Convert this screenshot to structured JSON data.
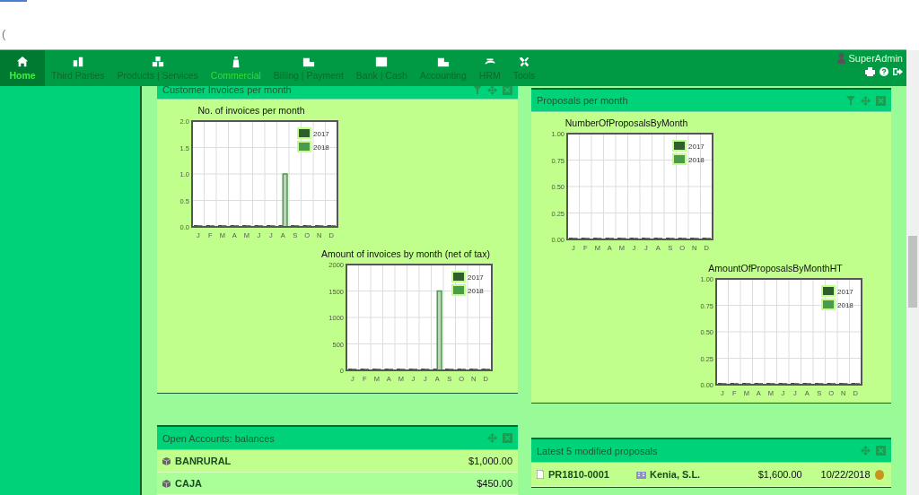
{
  "browser_stub": {
    "text": "("
  },
  "nav": {
    "items": [
      {
        "label": "Home",
        "selected": true,
        "active": false
      },
      {
        "label": "Third Parties",
        "selected": false,
        "active": false
      },
      {
        "label": "Products | Services",
        "selected": false,
        "active": false
      },
      {
        "label": "Commercial",
        "selected": false,
        "active": true
      },
      {
        "label": "Billing | Payment",
        "selected": false,
        "active": false
      },
      {
        "label": "Bank | Cash",
        "selected": false,
        "active": false
      },
      {
        "label": "Accounting",
        "selected": false,
        "active": false
      },
      {
        "label": "HRM",
        "selected": false,
        "active": false
      },
      {
        "label": "Tools",
        "selected": false,
        "active": false
      }
    ],
    "user": "SuperAdmin"
  },
  "panels": [
    {
      "title": "Customer Invoices per month",
      "filter": true,
      "charts": [
        {
          "chart_data": {
            "type": "bar",
            "grid": true,
            "legend": true,
            "title": "No. of invoices per month",
            "categories": [
              "J",
              "F",
              "M",
              "A",
              "M",
              "J",
              "J",
              "A",
              "S",
              "O",
              "N",
              "D"
            ],
            "ylim": [
              0,
              2
            ],
            "yticks": [
              {
                "value": 0,
                "label": "0.0"
              },
              {
                "value": 0.5,
                "label": "0.5"
              },
              {
                "value": 1,
                "label": "1.0"
              },
              {
                "value": 1.5,
                "label": "1.5"
              },
              {
                "value": 2,
                "label": "2.0"
              }
            ],
            "series": [
              {
                "name": "2017",
                "color": "#2e5e2e",
                "values": [
                  0,
                  0,
                  0,
                  0,
                  0,
                  0,
                  0,
                  0,
                  0,
                  0,
                  0,
                  0
                ]
              },
              {
                "name": "2018",
                "color": "#4c9a4c",
                "values": [
                  0,
                  0,
                  0,
                  0,
                  0,
                  0,
                  0,
                  1,
                  0,
                  0,
                  0,
                  0
                ]
              }
            ]
          }
        },
        {
          "chart_data": {
            "type": "bar",
            "grid": true,
            "legend": true,
            "title": "Amount of invoices by month (net of tax)",
            "categories": [
              "J",
              "F",
              "M",
              "A",
              "M",
              "J",
              "J",
              "A",
              "S",
              "O",
              "N",
              "D"
            ],
            "ylim": [
              0,
              2000
            ],
            "yticks": [
              0,
              500,
              1000,
              1500,
              2000
            ],
            "series": [
              {
                "name": "2017",
                "color": "#2e5e2e",
                "values": [
                  0,
                  0,
                  0,
                  0,
                  0,
                  0,
                  0,
                  0,
                  0,
                  0,
                  0,
                  0
                ]
              },
              {
                "name": "2018",
                "color": "#4c9a4c",
                "values": [
                  0,
                  0,
                  0,
                  0,
                  0,
                  0,
                  0,
                  1500,
                  0,
                  0,
                  0,
                  0
                ]
              }
            ]
          }
        }
      ]
    },
    {
      "title": "Proposals per month",
      "filter": true,
      "charts": [
        {
          "chart_data": {
            "type": "bar",
            "grid": true,
            "legend": true,
            "title": "NumberOfProposalsByMonth",
            "categories": [
              "J",
              "F",
              "M",
              "A",
              "M",
              "J",
              "J",
              "A",
              "S",
              "O",
              "N",
              "D"
            ],
            "ylim": [
              0,
              1
            ],
            "yticks": [
              {
                "value": 0,
                "label": "0.00"
              },
              {
                "value": 0.25,
                "label": "0.25"
              },
              {
                "value": 0.5,
                "label": "0.50"
              },
              {
                "value": 0.75,
                "label": "0.75"
              },
              {
                "value": 1,
                "label": "1.00"
              }
            ],
            "series": [
              {
                "name": "2017",
                "color": "#2e5e2e",
                "values": [
                  0,
                  0,
                  0,
                  0,
                  0,
                  0,
                  0,
                  0,
                  0,
                  0,
                  0,
                  0
                ]
              },
              {
                "name": "2018",
                "color": "#4c9a4c",
                "values": [
                  0,
                  0,
                  0,
                  0,
                  0,
                  0,
                  0,
                  0,
                  0,
                  0,
                  0,
                  0
                ]
              }
            ]
          }
        },
        {
          "chart_data": {
            "type": "bar",
            "grid": true,
            "legend": true,
            "title": "AmountOfProposalsByMonthHT",
            "categories": [
              "J",
              "F",
              "M",
              "A",
              "M",
              "J",
              "J",
              "A",
              "S",
              "O",
              "N",
              "D"
            ],
            "ylim": [
              0,
              1
            ],
            "yticks": [
              {
                "value": 0,
                "label": "0.00"
              },
              {
                "value": 0.25,
                "label": "0.25"
              },
              {
                "value": 0.5,
                "label": "0.50"
              },
              {
                "value": 0.75,
                "label": "0.75"
              },
              {
                "value": 1,
                "label": "1.00"
              }
            ],
            "series": [
              {
                "name": "2017",
                "color": "#2e5e2e",
                "values": [
                  0,
                  0,
                  0,
                  0,
                  0,
                  0,
                  0,
                  0,
                  0,
                  0,
                  0,
                  0
                ]
              },
              {
                "name": "2018",
                "color": "#4c9a4c",
                "values": [
                  0,
                  0,
                  0,
                  0,
                  0,
                  0,
                  0,
                  0,
                  0,
                  0,
                  0,
                  0
                ]
              }
            ]
          }
        }
      ]
    }
  ],
  "accounts": {
    "title": "Open Accounts: balances",
    "rows": [
      {
        "name": "BANRURAL",
        "amount": "$1,000.00"
      },
      {
        "name": "CAJA",
        "amount": "$450.00"
      }
    ]
  },
  "proposals": {
    "title": "Latest 5 modified proposals",
    "rows": [
      {
        "ref": "PR1810-0001",
        "company": "Kenia, S.L.",
        "amount": "$1,600.00",
        "date": "10/22/2018",
        "color": "#c8961e"
      }
    ]
  }
}
